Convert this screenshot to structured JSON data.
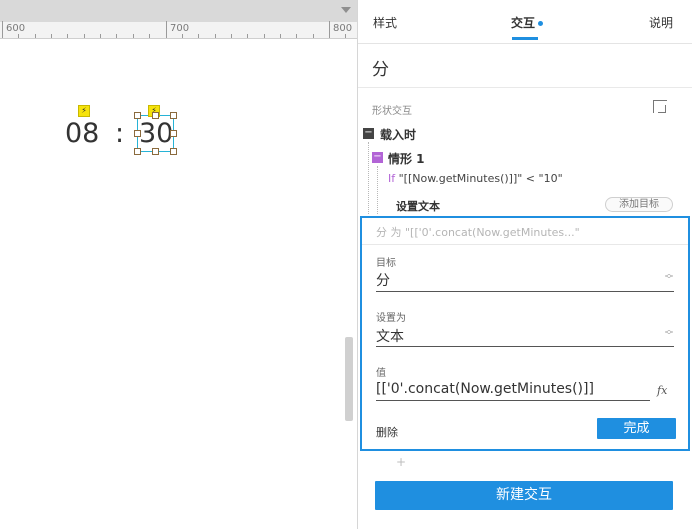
{
  "ruler": {
    "labels": [
      "600",
      "700",
      "800"
    ]
  },
  "canvas": {
    "hours_text": "08",
    "colon_text": ":",
    "minutes_text": "30",
    "bolt_glyph": "⚡"
  },
  "panel": {
    "tabs": [
      {
        "label": "样式",
        "active": false
      },
      {
        "label": "交互",
        "active": true
      },
      {
        "label": "说明",
        "active": false
      }
    ],
    "shape_name": "分",
    "section_title": "形状交互",
    "event_label": "载入时",
    "case_label": "情形 1",
    "condition": {
      "if_keyword": "If",
      "expression": "\"[[Now.getMinutes()]]\" < \"10\""
    },
    "action_label": "设置文本",
    "add_target_label": "添加目标",
    "edit": {
      "summary": "分 为 \"[['0'.concat(Now.getMinutes...\"",
      "target_label": "目标",
      "target_value": "分",
      "set_to_label": "设置为",
      "set_to_value": "文本",
      "value_label": "值",
      "value_text": "[['0'.concat(Now.getMinutes()]]",
      "fx_label": "fx",
      "delete_label": "删除",
      "done_label": "完成"
    },
    "plus_label": "+",
    "new_interaction_label": "新建交互"
  },
  "colors": {
    "accent": "#1f8fe0",
    "event_marker": "#444444",
    "case_marker": "#b264d6",
    "selection": "#27b3d6",
    "bolt": "#f6e30b"
  }
}
